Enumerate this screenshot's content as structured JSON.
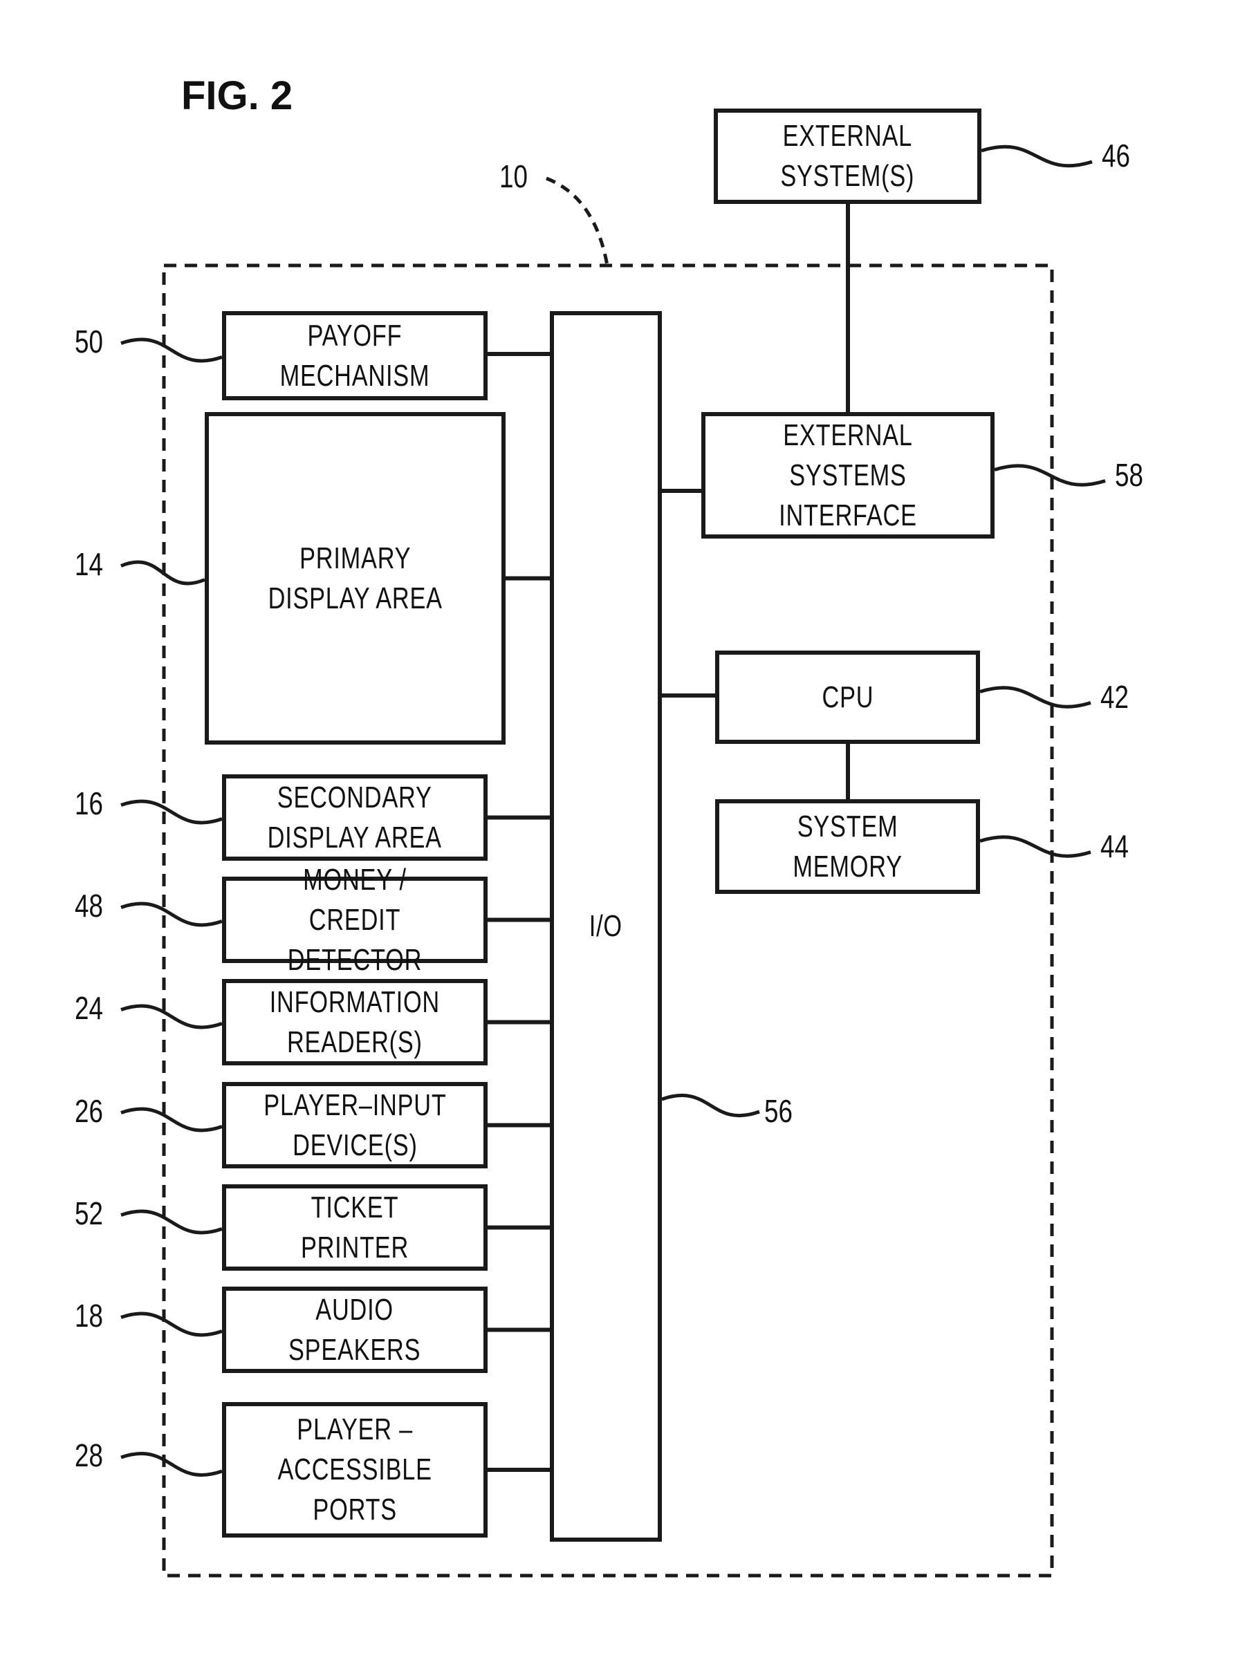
{
  "figure": {
    "title": "FIG. 2"
  },
  "system_ref": "10",
  "bus": {
    "label": "I/O",
    "ref": "56"
  },
  "external": [
    {
      "id": "external-systems",
      "label": "EXTERNAL\nSYSTEM(S)",
      "ref": "46"
    },
    {
      "id": "external-systems-interface",
      "label": "EXTERNAL\nSYSTEMS\nINTERFACE",
      "ref": "58"
    },
    {
      "id": "cpu",
      "label": "CPU",
      "ref": "42"
    },
    {
      "id": "system-memory",
      "label": "SYSTEM\nMEMORY",
      "ref": "44"
    }
  ],
  "components": [
    {
      "id": "payoff-mechanism",
      "label": "PAYOFF\nMECHANISM",
      "ref": "50"
    },
    {
      "id": "primary-display-area",
      "label": "PRIMARY\nDISPLAY  AREA",
      "ref": "14"
    },
    {
      "id": "secondary-display-area",
      "label": "SECONDARY\nDISPLAY  AREA",
      "ref": "16"
    },
    {
      "id": "money-credit-detector",
      "label": "MONEY / CREDIT\nDETECTOR",
      "ref": "48"
    },
    {
      "id": "information-readers",
      "label": "INFORMATION\nREADER(S)",
      "ref": "24"
    },
    {
      "id": "player-input-devices",
      "label": "PLAYER–INPUT\nDEVICE(S)",
      "ref": "26"
    },
    {
      "id": "ticket-printer",
      "label": "TICKET  PRINTER",
      "ref": "52"
    },
    {
      "id": "audio-speakers",
      "label": "AUDIO\nSPEAKERS",
      "ref": "18"
    },
    {
      "id": "player-accessible-ports",
      "label": "PLAYER  –\nACCESSIBLE\nPORTS",
      "ref": "28"
    }
  ]
}
